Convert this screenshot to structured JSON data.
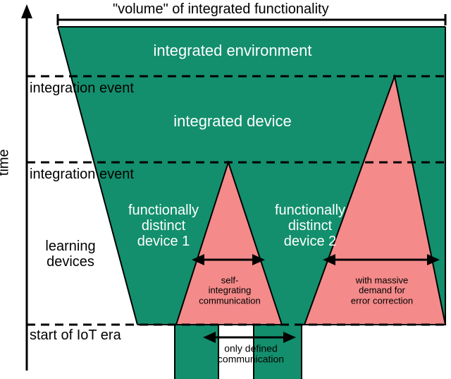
{
  "axes": {
    "y_label": "time",
    "bracket_top": "\"volume\" of integrated functionality"
  },
  "labels": {
    "integrated_environment": "integrated environment",
    "integrated_device": "integrated device",
    "device1": "functionally\ndistinct\ndevice 1",
    "device2": "functionally\ndistinct\ndevice 2",
    "learning_devices": "learning\ndevices",
    "integration_event_upper": "integration event",
    "integration_event_lower": "integration event",
    "start_iot": "start of IoT era",
    "self_integrating": "self-\nintegrating\ncommunication",
    "massive_demand": "with massive\ndemand for\nerror correction",
    "only_defined": "only defined\ncommunication"
  },
  "chart_data": {
    "type": "diagram",
    "title": "\"volume\" of integrated functionality",
    "y_axis": "time",
    "time_stages": [
      "start of IoT era",
      "learning devices",
      "integration event (first)",
      "integrated device",
      "integration event (second)",
      "integrated environment"
    ],
    "devices": [
      {
        "name": "functionally distinct device 1",
        "communication_note": "self-integrating communication"
      },
      {
        "name": "functionally distinct device 2",
        "communication_note": "with massive demand for error correction"
      }
    ],
    "baseline_note": "only defined communication",
    "colors": {
      "environment": "#138f6d",
      "device_comm": "#f48a8a"
    }
  }
}
